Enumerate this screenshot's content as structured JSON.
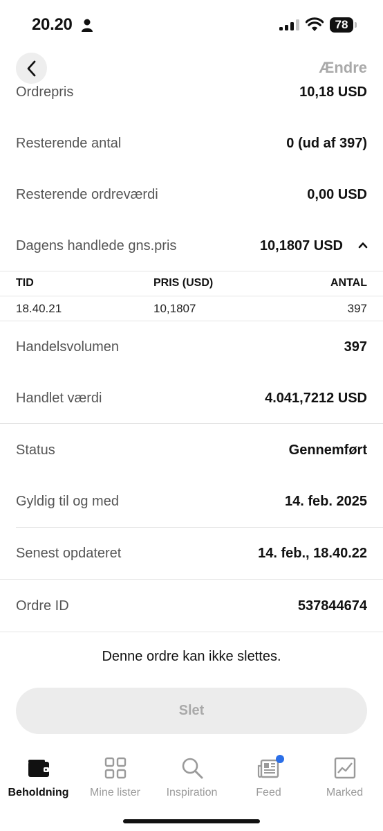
{
  "status_bar": {
    "time": "20.20",
    "battery": "78"
  },
  "nav": {
    "edit_label": "Ændre"
  },
  "rows": {
    "ordrepris": {
      "label": "Ordrepris",
      "value": "10,18 USD"
    },
    "resterende_antal": {
      "label": "Resterende antal",
      "value": "0 (ud af 397)"
    },
    "resterende_ordrevaerdi": {
      "label": "Resterende ordreværdi",
      "value": "0,00 USD"
    },
    "dagens_gns_pris": {
      "label": "Dagens handlede gns.pris",
      "value": "10,1807 USD"
    },
    "handelsvolumen": {
      "label": "Handelsvolumen",
      "value": "397"
    },
    "handlet_vaerdi": {
      "label": "Handlet værdi",
      "value": "4.041,7212 USD"
    },
    "status": {
      "label": "Status",
      "value": "Gennemført"
    },
    "gyldig": {
      "label": "Gyldig til og med",
      "value": "14. feb. 2025"
    },
    "opdateret": {
      "label": "Senest opdateret",
      "value": "14. feb., 18.40.22"
    },
    "ordre_id": {
      "label": "Ordre ID",
      "value": "537844674"
    }
  },
  "trades": {
    "headers": {
      "time": "TID",
      "price": "PRIS (USD)",
      "quantity": "ANTAL"
    },
    "rows": [
      {
        "time": "18.40.21",
        "price": "10,1807",
        "quantity": "397"
      }
    ]
  },
  "notice": "Denne ordre kan ikke slettes.",
  "delete_button": "Slet",
  "tabs": [
    {
      "label": "Beholdning",
      "icon": "wallet-icon",
      "active": true
    },
    {
      "label": "Mine lister",
      "icon": "grid-icon"
    },
    {
      "label": "Inspiration",
      "icon": "search-icon"
    },
    {
      "label": "Feed",
      "icon": "newspaper-icon",
      "badge_color": "#2b6fe8"
    },
    {
      "label": "Marked",
      "icon": "chart-icon"
    }
  ]
}
